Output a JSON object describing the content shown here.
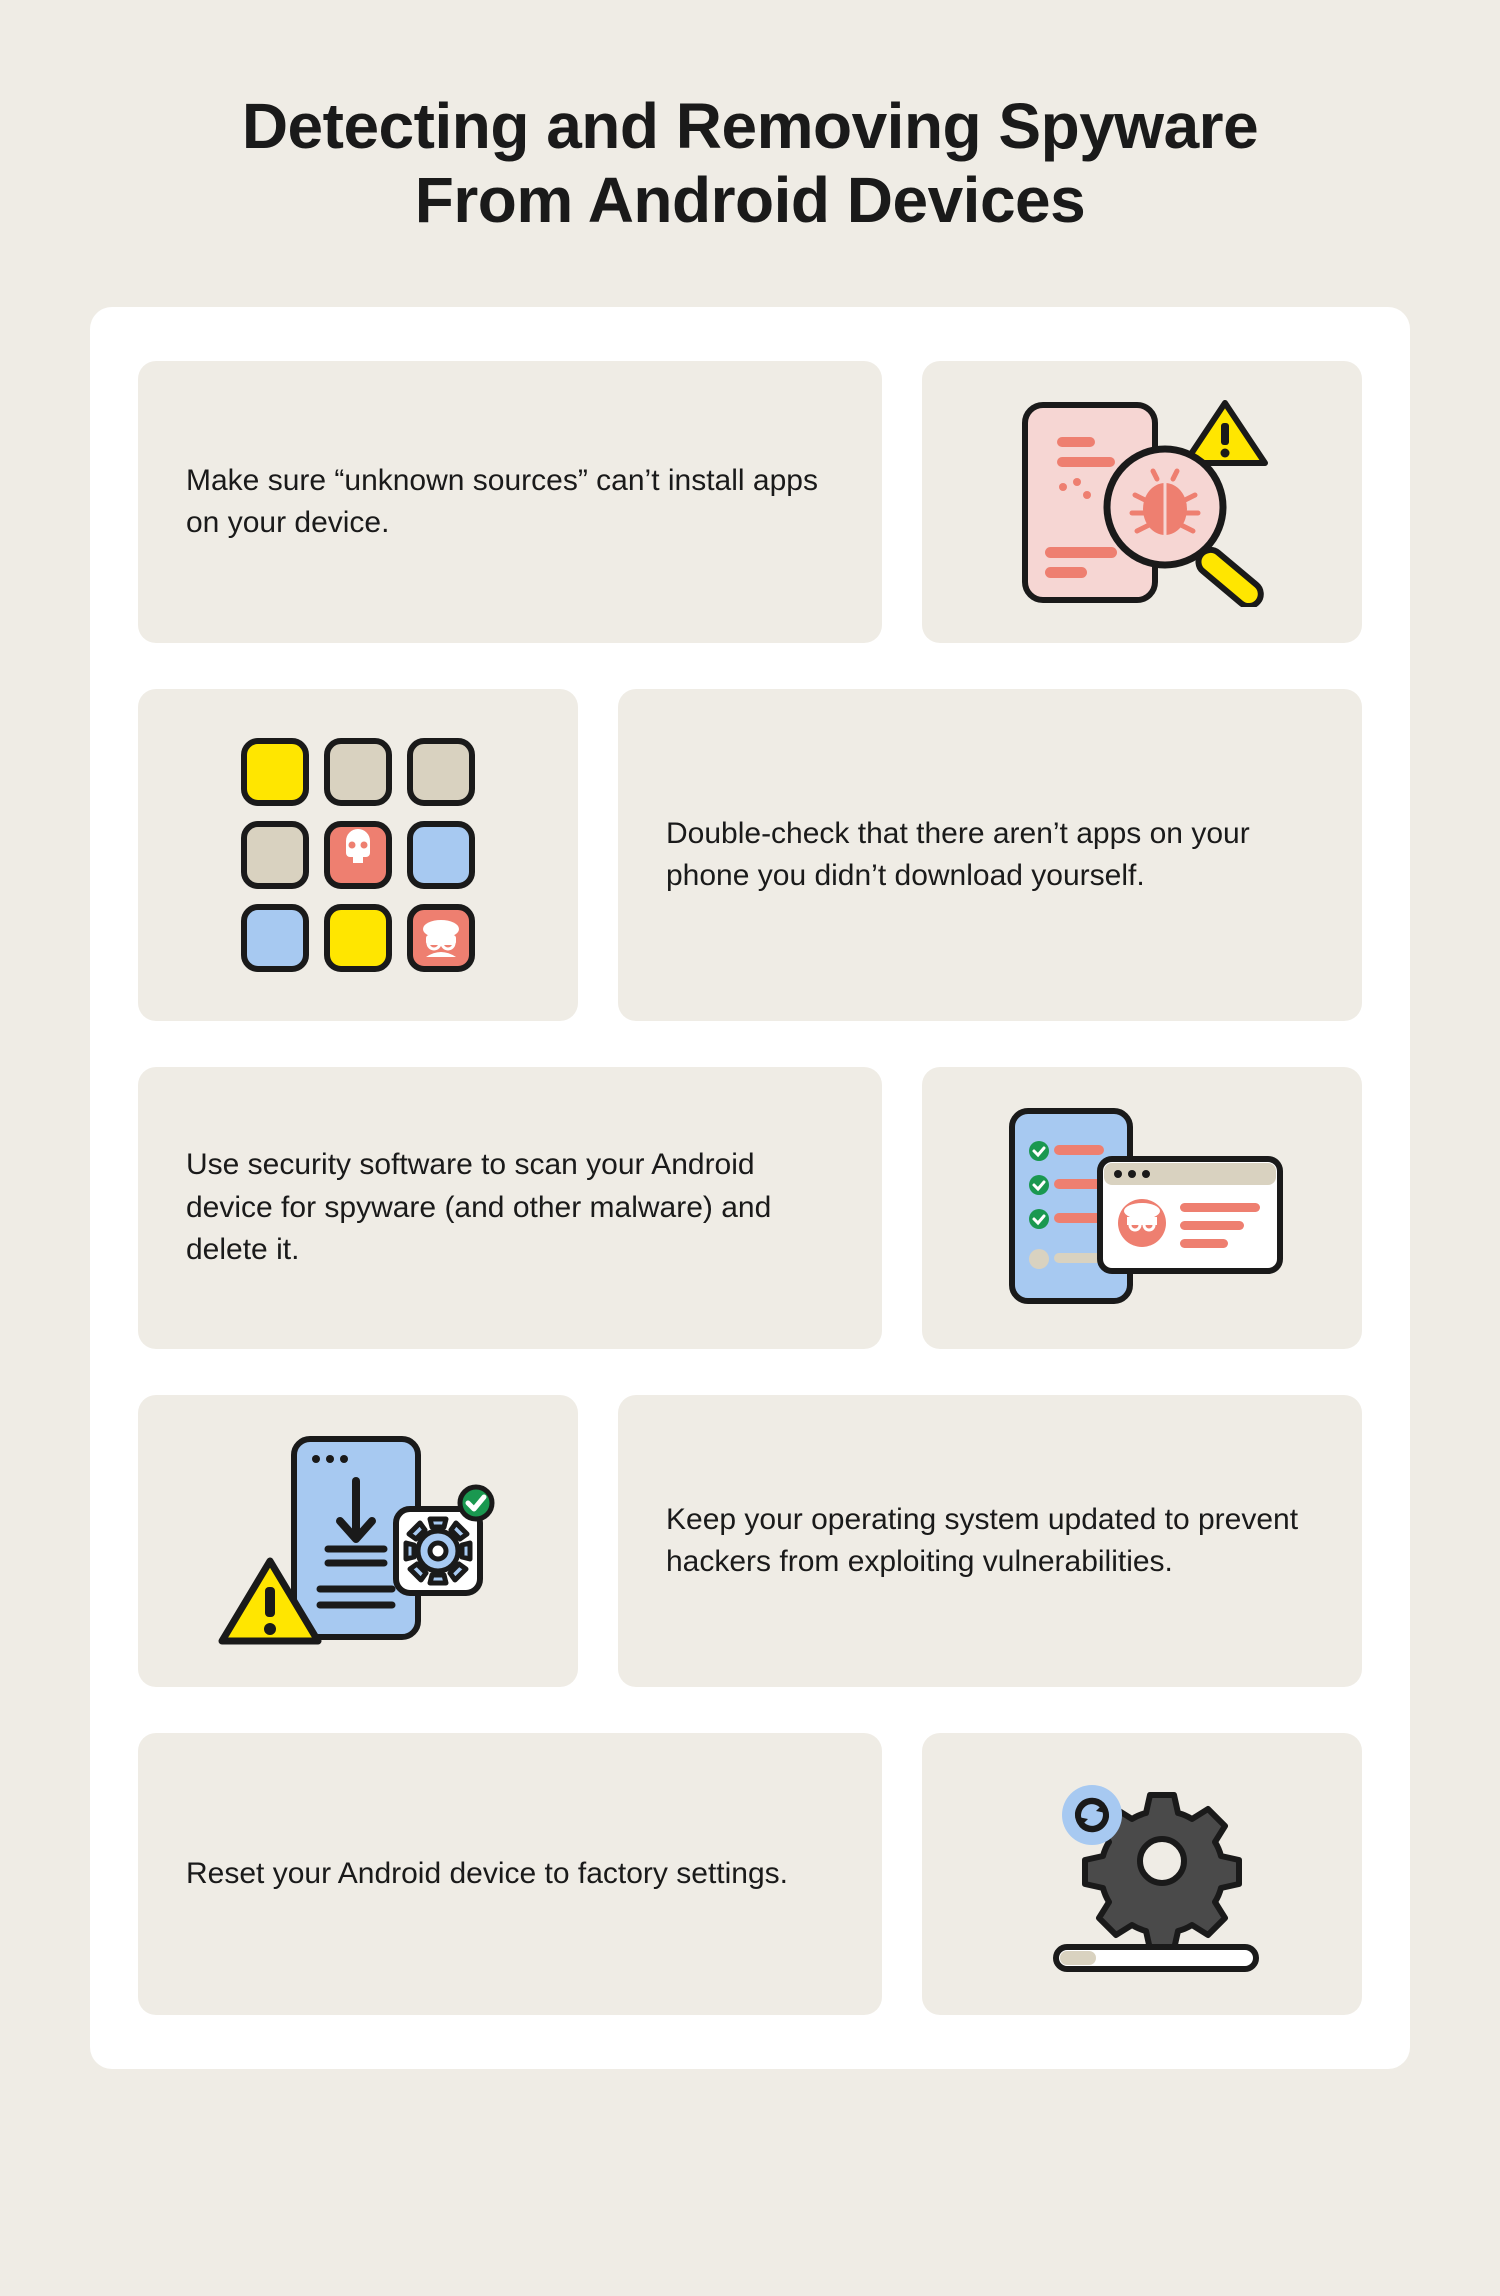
{
  "title_line1": "Detecting and Removing Spyware",
  "title_line2": "From Android Devices",
  "tips": [
    {
      "text": "Make sure “unknown sources” can’t install apps on your device."
    },
    {
      "text": "Double-check that there aren’t apps on your phone you didn’t download yourself."
    },
    {
      "text": "Use security software to scan your Android device for spyware (and other malware) and delete it."
    },
    {
      "text": "Keep your operating system updated to prevent hackers from exploiting vulnerabilities."
    },
    {
      "text": "Reset your Android device to factory settings."
    }
  ],
  "colors": {
    "bg": "#efece5",
    "panel": "#ffffff",
    "card": "#efece5",
    "text": "#1a1a1a",
    "yellow": "#ffe600",
    "coral": "#ee7f70",
    "blue": "#a7c9f1",
    "green": "#1a9850",
    "gray": "#4a4a4a",
    "beige": "#d9d2c0"
  }
}
